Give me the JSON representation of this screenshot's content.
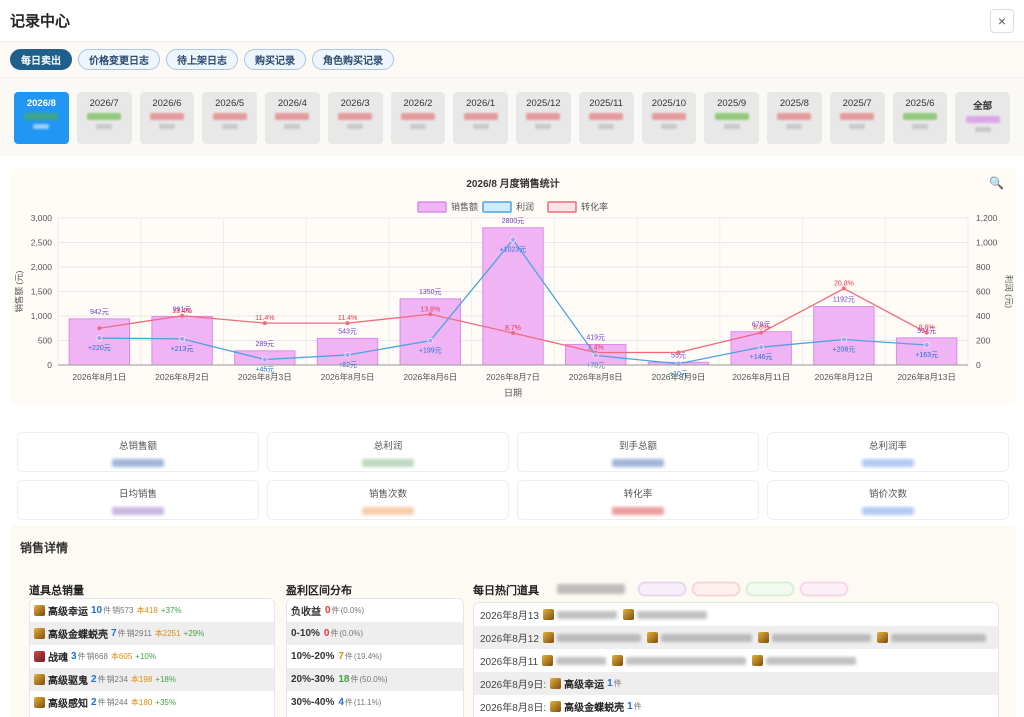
{
  "header": {
    "title": "记录中心",
    "close_icon": "×"
  },
  "tabs": [
    "每日卖出",
    "价格变更日志",
    "待上架日志",
    "购买记录",
    "角色购买记录"
  ],
  "months": [
    {
      "label": "2026/8",
      "active": true,
      "color": "#4caf50"
    },
    {
      "label": "2026/7",
      "color": "#66bb44"
    },
    {
      "label": "2026/6",
      "color": "#e57373"
    },
    {
      "label": "2026/5",
      "color": "#e57373"
    },
    {
      "label": "2026/4",
      "color": "#e57373"
    },
    {
      "label": "2026/3",
      "color": "#e57373"
    },
    {
      "label": "2026/2",
      "color": "#e57373"
    },
    {
      "label": "2026/1",
      "color": "#e57373"
    },
    {
      "label": "2025/12",
      "color": "#e57373"
    },
    {
      "label": "2025/11",
      "color": "#e57373"
    },
    {
      "label": "2025/10",
      "color": "#e57373"
    },
    {
      "label": "2025/9",
      "color": "#66bb44"
    },
    {
      "label": "2025/8",
      "color": "#e57373"
    },
    {
      "label": "2025/7",
      "color": "#e57373"
    },
    {
      "label": "2025/6",
      "color": "#66bb44"
    },
    {
      "label": "全部",
      "color": "#d685e8"
    }
  ],
  "chart_data": {
    "type": "bar",
    "title": "2026/8 月度销售统计",
    "xlabel": "日期",
    "ylabel": "销售额 (元)",
    "y2label": "利润 (元)",
    "ylim": [
      0,
      3000
    ],
    "y2lim": [
      0,
      1200
    ],
    "yticks": [
      "0",
      "500",
      "1,000",
      "1,500",
      "2,000",
      "2,500",
      "3,000"
    ],
    "y2ticks": [
      "0",
      "200",
      "400",
      "600",
      "800",
      "1,000",
      "1,200"
    ],
    "legend": [
      "销售额",
      "利润",
      "转化率"
    ],
    "legend_position": "top-center",
    "categories": [
      "2026年8月1日",
      "2026年8月2日",
      "2026年8月3日",
      "2026年8月5日",
      "2026年8月6日",
      "2026年8月7日",
      "2026年8月8日",
      "2026年8月9日",
      "2026年8月11日",
      "2026年8月12日",
      "2026年8月13日"
    ],
    "series": [
      {
        "name": "销售额",
        "values": [
          942,
          991,
          289,
          543,
          1350,
          2800,
          419,
          55,
          679,
          1192,
          554
        ],
        "labels": [
          "942元",
          "991元",
          "289元",
          "543元",
          "1350元",
          "2800元",
          "419元",
          "55元",
          "679元",
          "1192元",
          "554元"
        ]
      },
      {
        "name": "利润",
        "values": [
          220,
          213,
          45,
          82,
          199,
          1023,
          78,
          10,
          146,
          208,
          163
        ],
        "labels": [
          "+220元",
          "+213元",
          "+45元",
          "+82元",
          "+199元",
          "+1023元",
          "+78元",
          "+10元",
          "+146元",
          "+208元",
          "+163元"
        ]
      },
      {
        "name": "转化率",
        "values": [
          10,
          13.4,
          11.4,
          11.4,
          13.8,
          8.7,
          3.4,
          3.4,
          8.8,
          20.8,
          8.8
        ],
        "labels": [
          "",
          "13.4%",
          "11.4%",
          "11.4%",
          "13.8%",
          "8.7%",
          "3.4%",
          "",
          "8.8%",
          "20.8%",
          "8.8%"
        ]
      }
    ],
    "colors": {
      "bar": "#f0b4f5",
      "bar_border": "#d98ce6",
      "profit": "#4aa3df",
      "profit_point": "#a6a1f0",
      "rate": "#f06a7c"
    },
    "grid": true
  },
  "stats": {
    "row1": [
      "总销售额",
      "总利润",
      "到手总额",
      "总利润率"
    ],
    "row2": [
      "日均销售",
      "销售次数",
      "转化率",
      "销价次数"
    ],
    "row1_colors": [
      "#7896c8",
      "#9fc7a2",
      "#7896c8",
      "#8fb5e8"
    ],
    "row2_colors": [
      "#b497d6",
      "#f2b98a",
      "#e57373",
      "#8fb5e8"
    ]
  },
  "details": {
    "title": "销售详情",
    "items_title": "道具总销量",
    "items": [
      {
        "name": "高级幸运",
        "count": "10",
        "unit": "件",
        "sold": "销573",
        "cost": "本418",
        "pct": "+37%"
      },
      {
        "name": "高级金蝶蜕壳",
        "count": "7",
        "unit": "件",
        "sold": "销2911",
        "cost": "本2251",
        "pct": "+29%"
      },
      {
        "name": "战魂",
        "count": "3",
        "unit": "件",
        "sold": "销668",
        "cost": "本605",
        "pct": "+10%",
        "icon": "red"
      },
      {
        "name": "高级驱鬼",
        "count": "2",
        "unit": "件",
        "sold": "销234",
        "cost": "本198",
        "pct": "+18%"
      },
      {
        "name": "高级感知",
        "count": "2",
        "unit": "件",
        "sold": "销244",
        "cost": "本180",
        "pct": "+35%"
      }
    ],
    "profit_title": "盈利区间分布",
    "profit_ranges": [
      {
        "name": "负收益",
        "count": "0",
        "unit": "件",
        "pct": "(0.0%)",
        "color": "red"
      },
      {
        "name": "0-10%",
        "count": "0",
        "unit": "件",
        "pct": "(0.0%)",
        "color": "red"
      },
      {
        "name": "10%-20%",
        "count": "7",
        "unit": "件",
        "pct": "(19.4%)",
        "color": "orange"
      },
      {
        "name": "20%-30%",
        "count": "18",
        "unit": "件",
        "pct": "(50.0%)",
        "color": "green"
      },
      {
        "name": "30%-40%",
        "count": "4",
        "unit": "件",
        "pct": "(11.1%)",
        "color": "blue"
      }
    ],
    "hot_title": "每日热门道具",
    "hot_rows": [
      {
        "date": "2026年8月13"
      },
      {
        "date": "2026年8月12"
      },
      {
        "date": "2026年8月11"
      },
      {
        "date": "2026年8月9日:",
        "item": "高级幸运",
        "count": "1",
        "unit": "件"
      },
      {
        "date": "2026年8月8日:",
        "item": "高级金蝶蜕壳",
        "count": "1",
        "unit": "件"
      }
    ]
  }
}
